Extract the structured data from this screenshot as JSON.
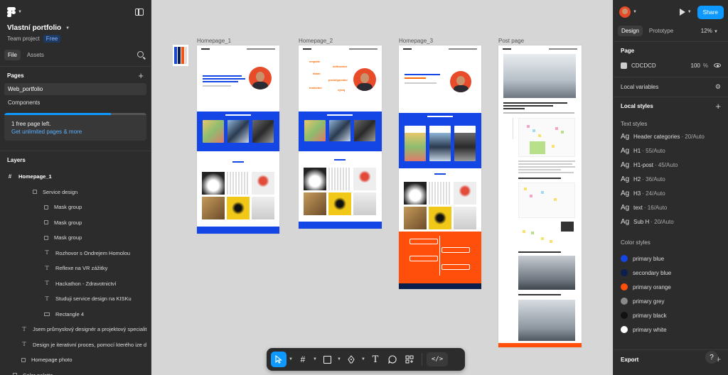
{
  "app": {
    "project_name": "Vlastní portfolio",
    "team_label": "Team project",
    "plan_badge": "Free"
  },
  "left_tabs": [
    "File",
    "Assets"
  ],
  "pages": {
    "title": "Pages",
    "items": [
      "Web_portfolio",
      "Components"
    ],
    "notice": "1 free page left.",
    "notice_link": "Get unlimited pages & more"
  },
  "layers": {
    "title": "Layers",
    "items": [
      {
        "label": "Homepage_1",
        "icon": "hash-icon"
      },
      {
        "label": "Service design",
        "icon": "frame-icon"
      },
      {
        "label": "Mask group",
        "icon": "frame-icon"
      },
      {
        "label": "Mask group",
        "icon": "frame-icon"
      },
      {
        "label": "Mask group",
        "icon": "frame-icon"
      },
      {
        "label": "Rozhovor s Ondrejem Homolou",
        "icon": "text-icon"
      },
      {
        "label": "Reflexe na VR zážitky",
        "icon": "text-icon"
      },
      {
        "label": "Hackathon - Zdravotnictví",
        "icon": "text-icon"
      },
      {
        "label": "Studuji service design na KISKu",
        "icon": "text-icon"
      },
      {
        "label": "Rectangle 4",
        "icon": "rect-icon"
      },
      {
        "label": "Jsem průmyslový designér a projektový specialit",
        "icon": "text-icon"
      },
      {
        "label": "Design je iterativní proces, pomocí  kterého ize d",
        "icon": "text-icon"
      },
      {
        "label": "Homepage photo",
        "icon": "frame-icon"
      },
      {
        "label": "Color palette",
        "icon": "frame-icon"
      }
    ]
  },
  "canvas": {
    "frames": [
      "Homepage_1",
      "Homepage_2",
      "Homepage_3",
      "Post page"
    ]
  },
  "right": {
    "tabs": [
      "Design",
      "Prototype"
    ],
    "zoom": "12%",
    "share_label": "Share",
    "page_section": "Page",
    "page_color_hex": "CDCDCD",
    "page_opacity": "100",
    "page_opacity_unit": "%",
    "local_variables": "Local variables",
    "local_styles": "Local styles",
    "text_styles_title": "Text styles",
    "text_styles": [
      {
        "name": "Header categories",
        "meta": "20/Auto"
      },
      {
        "name": "H1",
        "meta": "55/Auto"
      },
      {
        "name": "H1-post",
        "meta": "45/Auto"
      },
      {
        "name": "H2",
        "meta": "36/Auto"
      },
      {
        "name": "H3",
        "meta": "24/Auto"
      },
      {
        "name": "text",
        "meta": "16/Auto"
      },
      {
        "name": "Sub H",
        "meta": "20/Auto"
      }
    ],
    "ag_glyph": "Ag",
    "color_styles_title": "Color styles",
    "color_styles": [
      {
        "name": "primary blue",
        "color": "#1446e6"
      },
      {
        "name": "secondary blue",
        "color": "#0b1f4d"
      },
      {
        "name": "primary orange",
        "color": "#ff4f0a"
      },
      {
        "name": "primary grey",
        "color": "#8a8a8a"
      },
      {
        "name": "primary black",
        "color": "#111111"
      },
      {
        "name": "primary white",
        "color": "#ffffff"
      }
    ],
    "export_label": "Export",
    "help_label": "?"
  },
  "colors": {
    "accent": "#0d99ff",
    "brand_blue": "#1446e6",
    "brand_orange": "#ff4f0a"
  }
}
